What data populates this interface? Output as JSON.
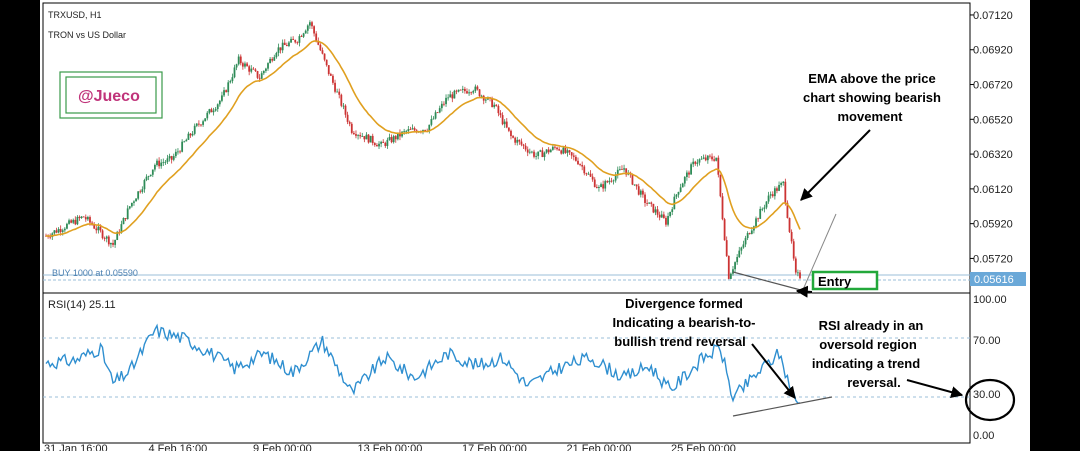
{
  "chart_data": [
    {
      "type": "line",
      "title": "TRXUSD, H1",
      "subtitle": "TRON vs US Dollar",
      "series": [],
      "ylim": [
        0.0555,
        0.0716
      ],
      "y_ticks": [
        "0.07120",
        "0.06920",
        "0.06720",
        "0.06520",
        "0.06320",
        "0.06120",
        "0.05920",
        "0.05720"
      ],
      "current_price": "0.05616",
      "order_line": "BUY 1000 at 0.05590",
      "grid": false,
      "candles_color_up": "#2e8b57",
      "candles_color_down": "#cc3333",
      "ema_color": "#e0a020",
      "anchors": [
        [
          0,
          0.0585
        ],
        [
          18,
          0.0596
        ],
        [
          26,
          0.0587
        ],
        [
          32,
          0.058
        ],
        [
          40,
          0.0602
        ],
        [
          52,
          0.0626
        ],
        [
          60,
          0.0629
        ],
        [
          72,
          0.0648
        ],
        [
          84,
          0.0664
        ],
        [
          92,
          0.0686
        ],
        [
          102,
          0.0676
        ],
        [
          110,
          0.0692
        ],
        [
          120,
          0.0698
        ],
        [
          126,
          0.0708
        ],
        [
          134,
          0.0682
        ],
        [
          146,
          0.0646
        ],
        [
          160,
          0.0637
        ],
        [
          172,
          0.0645
        ],
        [
          182,
          0.0647
        ],
        [
          192,
          0.0665
        ],
        [
          204,
          0.067
        ],
        [
          214,
          0.066
        ],
        [
          222,
          0.0642
        ],
        [
          234,
          0.0631
        ],
        [
          244,
          0.0636
        ],
        [
          254,
          0.0628
        ],
        [
          264,
          0.0612
        ],
        [
          276,
          0.0624
        ],
        [
          286,
          0.0605
        ],
        [
          296,
          0.0593
        ],
        [
          302,
          0.0612
        ],
        [
          310,
          0.0628
        ],
        [
          320,
          0.063
        ],
        [
          326,
          0.0562
        ],
        [
          336,
          0.0588
        ],
        [
          346,
          0.0609
        ],
        [
          352,
          0.0615
        ],
        [
          358,
          0.0562
        ]
      ]
    },
    {
      "type": "line",
      "title": "RSI(14) 25.11",
      "ylim": [
        0,
        100
      ],
      "y_ticks": [
        "100.00",
        "70.00",
        "30.00",
        "0.00"
      ],
      "levels": [
        70,
        30
      ],
      "line_color": "#2f8fd0",
      "anchors": [
        [
          0,
          53
        ],
        [
          14,
          55
        ],
        [
          26,
          64
        ],
        [
          32,
          38
        ],
        [
          40,
          47
        ],
        [
          52,
          77
        ],
        [
          66,
          71
        ],
        [
          78,
          61
        ],
        [
          90,
          49
        ],
        [
          104,
          60
        ],
        [
          118,
          46
        ],
        [
          132,
          69
        ],
        [
          146,
          31
        ],
        [
          162,
          57
        ],
        [
          176,
          42
        ],
        [
          192,
          60
        ],
        [
          206,
          51
        ],
        [
          218,
          57
        ],
        [
          230,
          36
        ],
        [
          246,
          50
        ],
        [
          260,
          57
        ],
        [
          276,
          42
        ],
        [
          288,
          51
        ],
        [
          298,
          33
        ],
        [
          314,
          57
        ],
        [
          322,
          64
        ],
        [
          328,
          27
        ],
        [
          342,
          49
        ],
        [
          350,
          60
        ],
        [
          358,
          24
        ]
      ]
    }
  ],
  "x_labels": [
    "31 Jan 16:00",
    "4 Feb 16:00",
    "9 Feb 00:00",
    "13 Feb 00:00",
    "17 Feb 00:00",
    "21 Feb 00:00",
    "25 Feb 00:00"
  ],
  "watermark": "@Jueco",
  "annotations": {
    "ema_note": [
      "EMA above the price",
      "chart showing bearish",
      "movement"
    ],
    "entry": "Entry",
    "divergence_note": [
      "Divergence formed",
      "Indicating a bearish-to-",
      "bullish trend reversal"
    ],
    "rsi_note": [
      "RSI already in an",
      "oversold region",
      "indicating a trend",
      "reversal."
    ]
  },
  "colors": {
    "panel_bg": "#ffffff",
    "frame": "#000000",
    "grid_dashed": "#9bbfd8",
    "entry_box": "#22a83a",
    "price_tag": "#6aa8d8"
  }
}
